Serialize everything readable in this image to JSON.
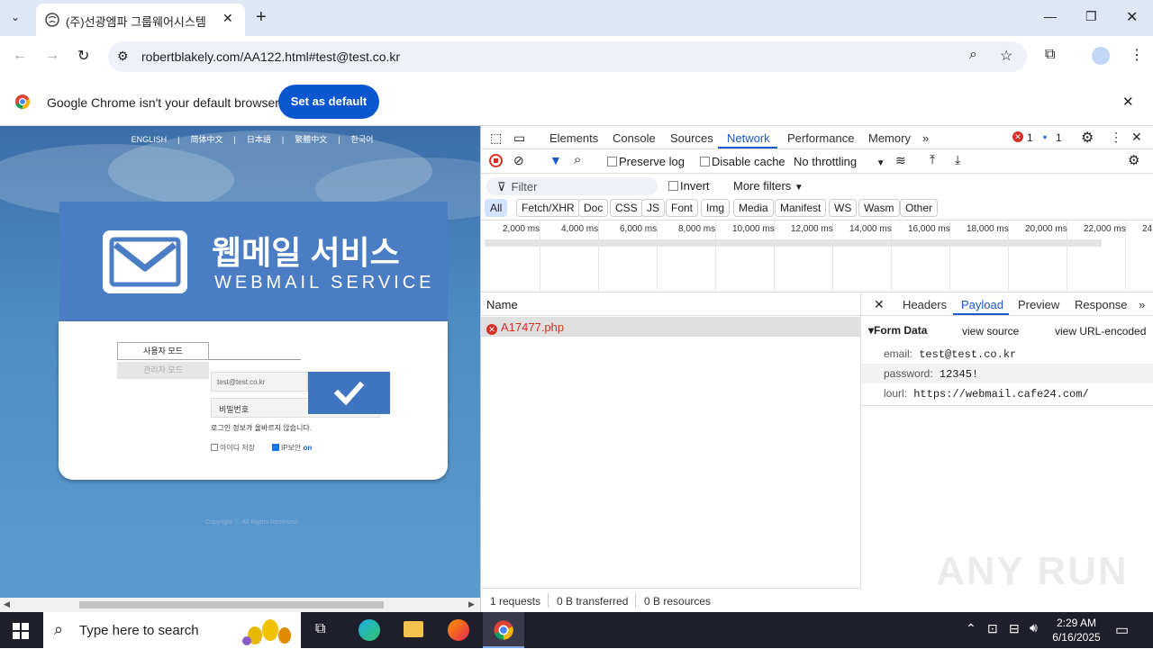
{
  "browser": {
    "tab_title": "(주)선광엠파 그룹웨어시스템",
    "url": "robertblakely.com/AA122.html#test@test.co.kr",
    "infobar_message": "Google Chrome isn't your default browser",
    "set_default_label": "Set as default"
  },
  "webpage": {
    "languages": [
      "ENGLISH",
      "|",
      "简体中文",
      "|",
      "日本語",
      "|",
      "繁體中文",
      "|",
      "한국어"
    ],
    "title_ko": "웹메일 서비스",
    "title_en": "WEBMAIL SERVICE",
    "tab_user": "사용자 모드",
    "tab_admin": "관리자 모드",
    "email_value": "test@test.co.kr",
    "password_placeholder": "비밀번호",
    "hint": "로그인 정보가 올바르지 않습니다.",
    "save_id_label": "아이디 저장",
    "ip_security_label": "IP보안",
    "ip_security_state": "on",
    "copyright": "Copyright ⓒ All Rights Reserved."
  },
  "devtools": {
    "tabs": [
      "Elements",
      "Console",
      "Sources",
      "Network",
      "Performance",
      "Memory"
    ],
    "active_tab": "Network",
    "error_count": "1",
    "message_count": "1",
    "preserve_log": "Preserve log",
    "disable_cache": "Disable cache",
    "throttling": "No throttling",
    "filter_placeholder": "Filter",
    "invert": "Invert",
    "more_filters": "More filters",
    "type_filters": [
      "All",
      "Fetch/XHR",
      "Doc",
      "CSS",
      "JS",
      "Font",
      "Img",
      "Media",
      "Manifest",
      "WS",
      "Wasm",
      "Other"
    ],
    "timeline_ticks": [
      "2,000 ms",
      "4,000 ms",
      "6,000 ms",
      "8,000 ms",
      "10,000 ms",
      "12,000 ms",
      "14,000 ms",
      "16,000 ms",
      "18,000 ms",
      "20,000 ms",
      "22,000 ms",
      "24"
    ],
    "name_header": "Name",
    "request_name": "A17477.php",
    "status_requests": "1 requests",
    "status_transferred": "0 B transferred",
    "status_resources": "0 B resources",
    "detail_tabs": [
      "Headers",
      "Payload",
      "Preview",
      "Response"
    ],
    "detail_active": "Payload",
    "form_data_title": "▾Form Data",
    "view_source": "view source",
    "view_url_encoded": "view URL-encoded",
    "form_data": [
      {
        "key": "email:",
        "value": "test@test.co.kr"
      },
      {
        "key": "password:",
        "value": "12345!"
      },
      {
        "key": "lourl:",
        "value": "https://webmail.cafe24.com/"
      }
    ]
  },
  "watermark": "ANY RUN",
  "taskbar": {
    "search_placeholder": "Type here to search",
    "time": "2:29 AM",
    "date": "6/16/2025"
  },
  "colors": {
    "accent": "#1a57d0",
    "page_bg": "#4f8cc4",
    "error": "#d93025"
  }
}
